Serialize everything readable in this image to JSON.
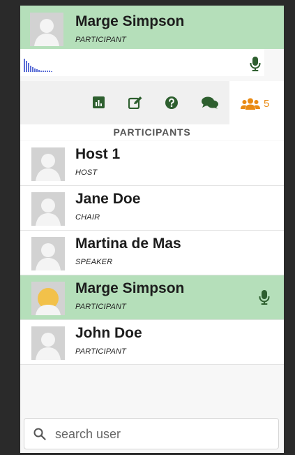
{
  "current_user": {
    "name": "Marge Simpson",
    "role": "PARTICIPANT"
  },
  "tabs": [
    {
      "icon": "poll-chart-icon"
    },
    {
      "icon": "edit-note-icon"
    },
    {
      "icon": "question-icon"
    },
    {
      "icon": "chat-bubbles-icon"
    },
    {
      "icon": "users-icon",
      "count": "5",
      "active": true
    }
  ],
  "section_title": "PARTICIPANTS",
  "participants": [
    {
      "name": "Host 1",
      "role": "HOST"
    },
    {
      "name": "Jane Doe",
      "role": "CHAIR"
    },
    {
      "name": "Martina de Mas",
      "role": "SPEAKER"
    },
    {
      "name": "Marge Simpson",
      "role": "PARTICIPANT",
      "highlighted": true,
      "speaking": true
    },
    {
      "name": "John Doe",
      "role": "PARTICIPANT"
    }
  ],
  "search": {
    "value": "",
    "placeholder": "search user"
  },
  "colors": {
    "highlight": "#b5dfba",
    "accent_orange": "#e98a13",
    "icon_green": "#2e5f2f",
    "audio_bar": "#5b6ed6"
  }
}
